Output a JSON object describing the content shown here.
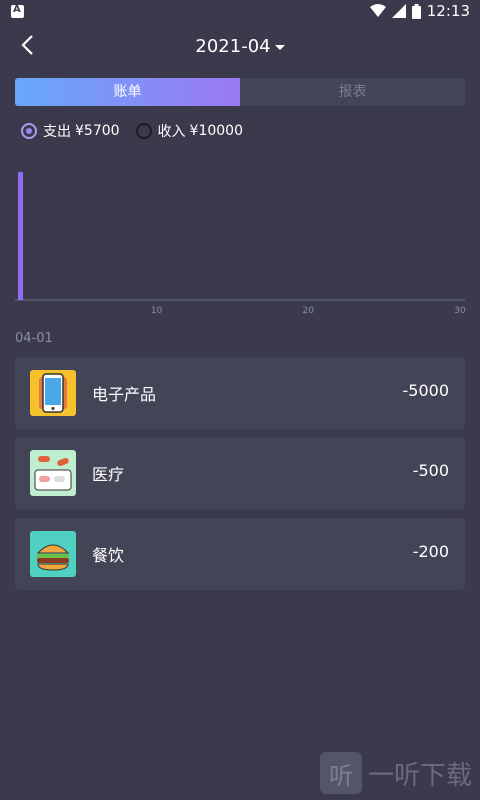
{
  "status": {
    "time": "12:13"
  },
  "header": {
    "month": "2021-04"
  },
  "tabs": [
    {
      "label": "账单",
      "active": true
    },
    {
      "label": "报表",
      "active": false
    }
  ],
  "filters": {
    "expense": {
      "label": "支出",
      "amount": "¥5700",
      "selected": true
    },
    "income": {
      "label": "收入",
      "amount": "¥10000",
      "selected": false
    }
  },
  "chart_data": {
    "type": "bar",
    "x": [
      1
    ],
    "values": [
      5700
    ],
    "xlim": [
      1,
      30
    ],
    "xticks": [
      "10",
      "20",
      "30"
    ],
    "color": "#8e6bf0"
  },
  "group": {
    "date": "04-01"
  },
  "items": [
    {
      "category": "电子产品",
      "amount": "-5000",
      "icon": "phone-icon"
    },
    {
      "category": "医疗",
      "amount": "-500",
      "icon": "medicine-icon"
    },
    {
      "category": "餐饮",
      "amount": "-200",
      "icon": "burger-icon"
    }
  ],
  "watermark": {
    "text": "一听下载",
    "glyph": "听"
  }
}
